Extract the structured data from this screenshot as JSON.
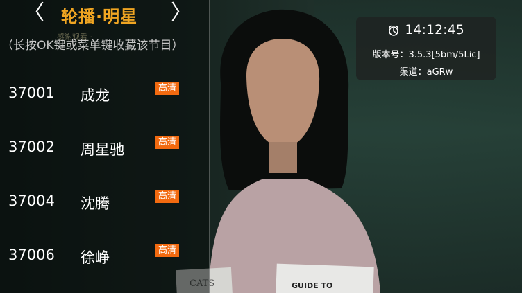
{
  "header": {
    "prev_arrow": "〈",
    "title": "轮播·明星",
    "next_arrow": "〉",
    "faded_text": "感谢观看 ·"
  },
  "hint": "（长按OK键或菜单键收藏该节目）",
  "channels": [
    {
      "number": "37001",
      "name": "成龙",
      "badge": "高清"
    },
    {
      "number": "37002",
      "name": "周星驰",
      "badge": "高清"
    },
    {
      "number": "37004",
      "name": "沈腾",
      "badge": "高清"
    },
    {
      "number": "37006",
      "name": "徐峥",
      "badge": "高清"
    }
  ],
  "info": {
    "time": "14:12:45",
    "version_label": "版本号：",
    "version": "3.5.3[5bm/5Lic]",
    "channel_label": "渠道：",
    "channel": "aGRw"
  },
  "video": {
    "book_text_left": "CATS",
    "book_text_right": "GUIDE TO"
  },
  "colors": {
    "title": "#f0a522",
    "badge": "#f26a10"
  }
}
